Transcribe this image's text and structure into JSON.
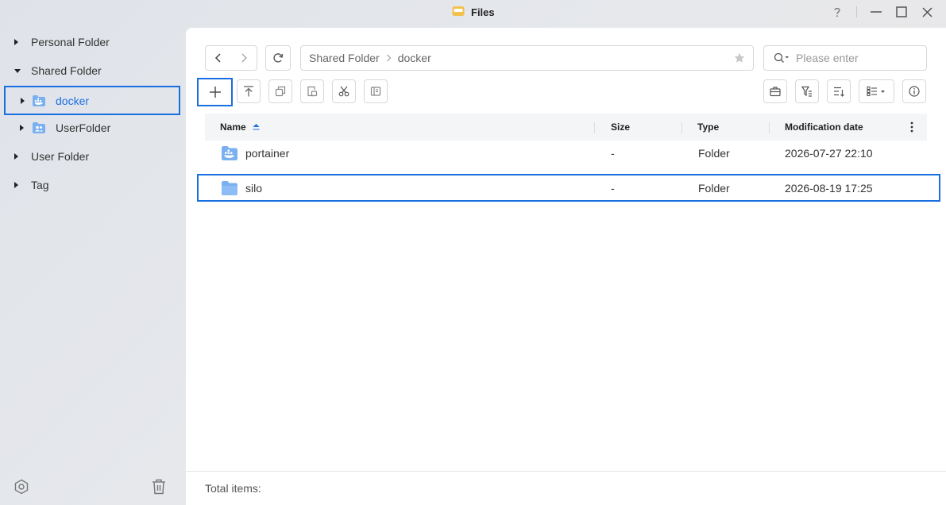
{
  "window": {
    "title": "Files",
    "accent_color": "#1a6fe0",
    "folder_color": "#f2c14b"
  },
  "sidebar": {
    "items": [
      {
        "label": "Personal Folder",
        "expanded": false
      },
      {
        "label": "Shared Folder",
        "expanded": true
      },
      {
        "label": "docker",
        "icon": "docker-folder-icon",
        "selected": true
      },
      {
        "label": "UserFolder",
        "icon": "user-folder-icon"
      },
      {
        "label": "User Folder",
        "expanded": false
      },
      {
        "label": "Tag",
        "expanded": false
      }
    ]
  },
  "breadcrumb": {
    "items": [
      "Shared Folder",
      "docker"
    ]
  },
  "search": {
    "placeholder": "Please enter",
    "value": ""
  },
  "table": {
    "columns": [
      "Name",
      "Size",
      "Type",
      "Modification date"
    ],
    "sort_column": "Name",
    "sort_direction": "ascending",
    "rows": [
      {
        "name": "portainer",
        "size": "-",
        "type": "Folder",
        "modified": "2026-07-27 22:10",
        "icon": "docker-folder-icon"
      },
      {
        "name": "silo",
        "size": "-",
        "type": "Folder",
        "modified": "2026-08-19 17:25",
        "icon": "folder-icon",
        "selected": true
      }
    ]
  },
  "footer": {
    "total_label": "Total items:"
  }
}
